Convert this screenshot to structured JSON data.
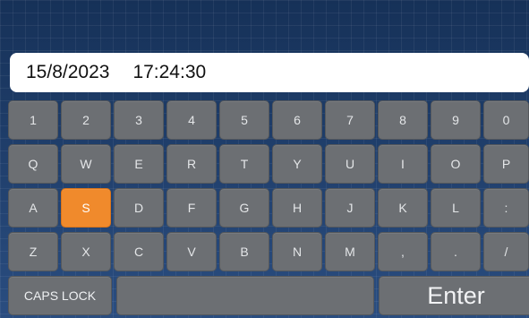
{
  "display": {
    "date": "15/8/2023",
    "time": "17:24:30"
  },
  "keyboard": {
    "rows": [
      [
        "1",
        "2",
        "3",
        "4",
        "5",
        "6",
        "7",
        "8",
        "9",
        "0"
      ],
      [
        "Q",
        "W",
        "E",
        "R",
        "T",
        "Y",
        "U",
        "I",
        "O",
        "P"
      ],
      [
        "A",
        "S",
        "D",
        "F",
        "G",
        "H",
        "J",
        "K",
        "L",
        ":"
      ],
      [
        "Z",
        "X",
        "C",
        "V",
        "B",
        "N",
        "M",
        ",",
        ".",
        "/"
      ]
    ],
    "caps_label": "CAPS LOCK",
    "space_label": "",
    "enter_label": "Enter",
    "active_key": "S"
  },
  "colors": {
    "active_key": "#f08a2c",
    "key": "#6c6f73",
    "background": "#1f3b66"
  }
}
